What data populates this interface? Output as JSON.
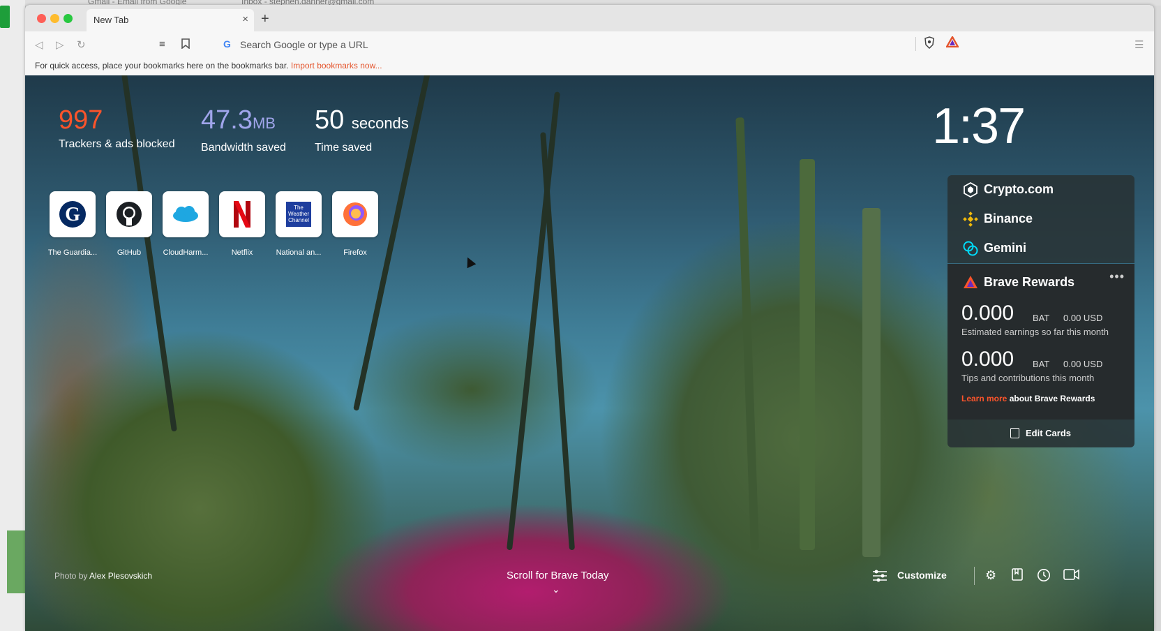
{
  "background_tabs": {
    "tab1": "Gmail - Email from Google",
    "tab2": "Inbox - stephen.danner@gmail.com"
  },
  "window": {
    "tab_title": "New Tab",
    "close_label": "×",
    "new_tab_label": "+"
  },
  "toolbar": {
    "search_placeholder": "Search Google or type a URL"
  },
  "bookmarks_bar": {
    "message": "For quick access, place your bookmarks here on the bookmarks bar.",
    "import_link": "Import bookmarks now..."
  },
  "stats": {
    "trackers_value": "997",
    "trackers_label": "Trackers & ads blocked",
    "trackers_color": "#fb542b",
    "bandwidth_value": "47.3",
    "bandwidth_unit": "MB",
    "bandwidth_label": "Bandwidth saved",
    "bandwidth_color": "#a0a5eb",
    "time_value": "50",
    "time_unit": "seconds",
    "time_label": "Time saved"
  },
  "clock": "1:37",
  "top_sites": [
    {
      "label": "The Guardia...",
      "icon": "guardian-icon"
    },
    {
      "label": "GitHub",
      "icon": "github-icon"
    },
    {
      "label": "CloudHarm...",
      "icon": "cloud-icon"
    },
    {
      "label": "Netflix",
      "icon": "netflix-icon"
    },
    {
      "label": "National an...",
      "icon": "weather-channel-icon"
    },
    {
      "label": "Firefox",
      "icon": "firefox-icon"
    }
  ],
  "weather_logo": {
    "line1": "The",
    "line2": "Weather",
    "line3": "Channel"
  },
  "crypto_cards": {
    "crypto_com": "Crypto.com",
    "binance": "Binance",
    "gemini": "Gemini"
  },
  "rewards": {
    "title": "Brave Rewards",
    "more": "•••",
    "earnings_amount": "0.000",
    "earnings_unit": "BAT",
    "earnings_usd": "0.00 USD",
    "earnings_desc": "Estimated earnings so far this month",
    "tips_amount": "0.000",
    "tips_unit": "BAT",
    "tips_usd": "0.00 USD",
    "tips_desc": "Tips and contributions this month",
    "learn_more": "Learn more",
    "learn_more_rest": " about Brave Rewards"
  },
  "edit_cards": "Edit Cards",
  "footer": {
    "photo_by": "Photo by",
    "photographer": "Alex Plesovskich",
    "scroll_today": "Scroll for Brave Today",
    "customize": "Customize"
  }
}
